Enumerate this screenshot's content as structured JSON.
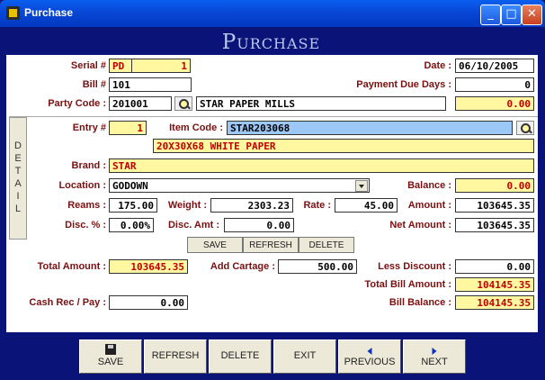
{
  "window": {
    "title": "Purchase",
    "min": "_",
    "max": "□",
    "close": "✕"
  },
  "banner": "Purchase",
  "header": {
    "serial_label": "Serial #",
    "serial_prefix": "PD",
    "serial_no": "1",
    "bill_label": "Bill #",
    "bill_no": "101",
    "party_label": "Party Code :",
    "party_code": "201001",
    "party_name": "STAR PAPER MILLS",
    "date_label": "Date :",
    "date": "06/10/2005",
    "due_label": "Payment Due Days :",
    "due_days": "0",
    "party_balance": "0.00"
  },
  "detail": {
    "tab_label": "DETAIL",
    "tab_chars": [
      "D",
      "E",
      "T",
      "A",
      "I",
      "L"
    ],
    "entry_label": "Entry #",
    "entry_no": "1",
    "item_label": "Item Code :",
    "item_code": "STAR203068",
    "item_desc": "20X30X68 WHITE PAPER",
    "brand_label": "Brand :",
    "brand": "STAR",
    "location_label": "Location :",
    "location": "GODOWN",
    "balance_label": "Balance :",
    "balance": "0.00",
    "reams_label": "Reams :",
    "reams": "175.00",
    "weight_label": "Weight :",
    "weight": "2303.23",
    "rate_label": "Rate :",
    "rate": "45.00",
    "amount_label": "Amount :",
    "amount": "103645.35",
    "disc_pct_label": "Disc. % :",
    "disc_pct": "0.00%",
    "disc_amt_label": "Disc. Amt :",
    "disc_amt": "0.00",
    "net_label": "Net Amount :",
    "net_amount": "103645.35",
    "save": "SAVE",
    "refresh": "REFRESH",
    "delete": "DELETE"
  },
  "totals": {
    "total_label": "Total Amount :",
    "total": "103645.35",
    "cartage_label": "Add Cartage :",
    "cartage": "500.00",
    "less_disc_label": "Less Discount :",
    "less_disc": "0.00",
    "bill_total_label": "Total Bill Amount :",
    "bill_total": "104145.35",
    "cash_label": "Cash Rec / Pay :",
    "cash": "0.00",
    "bill_balance_label": "Bill Balance :",
    "bill_balance": "104145.35"
  },
  "toolbar": {
    "save": "SAVE",
    "refresh": "REFRESH",
    "delete": "DELETE",
    "exit": "EXIT",
    "previous": "PREVIOUS",
    "next": "NEXT"
  }
}
